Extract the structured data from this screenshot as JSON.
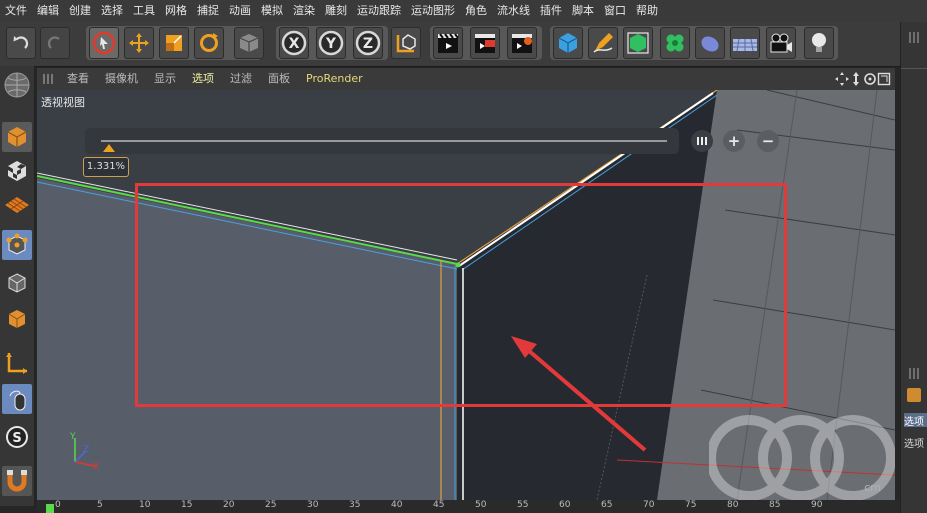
{
  "menubar": {
    "items": [
      "文件",
      "编辑",
      "创建",
      "选择",
      "工具",
      "网格",
      "捕捉",
      "动画",
      "模拟",
      "渲染",
      "雕刻",
      "运动跟踪",
      "运动图形",
      "角色",
      "流水线",
      "插件",
      "脚本",
      "窗口",
      "帮助"
    ]
  },
  "toolbar": {
    "icons": [
      "undo-icon",
      "redo-icon",
      "live-select-icon",
      "move-icon",
      "scale-icon",
      "rotate-icon",
      "object-mode-icon",
      "x-axis-icon",
      "y-axis-icon",
      "z-axis-icon",
      "coordinate-system-icon",
      "render-view-icon",
      "render-picture-viewer-icon",
      "render-settings-icon",
      "cube-icon",
      "pen-icon",
      "subdivision-icon",
      "cloner-icon",
      "deformer-icon",
      "floor-icon",
      "camera-icon",
      "light-icon"
    ],
    "axis_labels": [
      "X",
      "Y",
      "Z"
    ]
  },
  "viewport_menu": {
    "items": [
      "查看",
      "摄像机",
      "显示",
      "选项",
      "过滤",
      "面板",
      "ProRender"
    ],
    "active": "选项"
  },
  "viewport": {
    "label": "透视视图",
    "zoom_value": "1.331%",
    "zoom_fraction": 0.01331
  },
  "right_panel": {
    "tab_label": "选项",
    "row_label": "选项"
  },
  "timeline": {
    "ticks": [
      "0",
      "5",
      "10",
      "15",
      "20",
      "25",
      "30",
      "35",
      "40",
      "45",
      "50",
      "55",
      "60",
      "65",
      "70",
      "75",
      "80",
      "85",
      "90"
    ]
  },
  "watermark": "cm",
  "colors": {
    "highlight_box": "#e23a3a",
    "arrow": "#e23a3a",
    "edge_green": "#5ad94a",
    "edge_orange": "#e0a040",
    "accent_yellow": "#e6d87a"
  }
}
